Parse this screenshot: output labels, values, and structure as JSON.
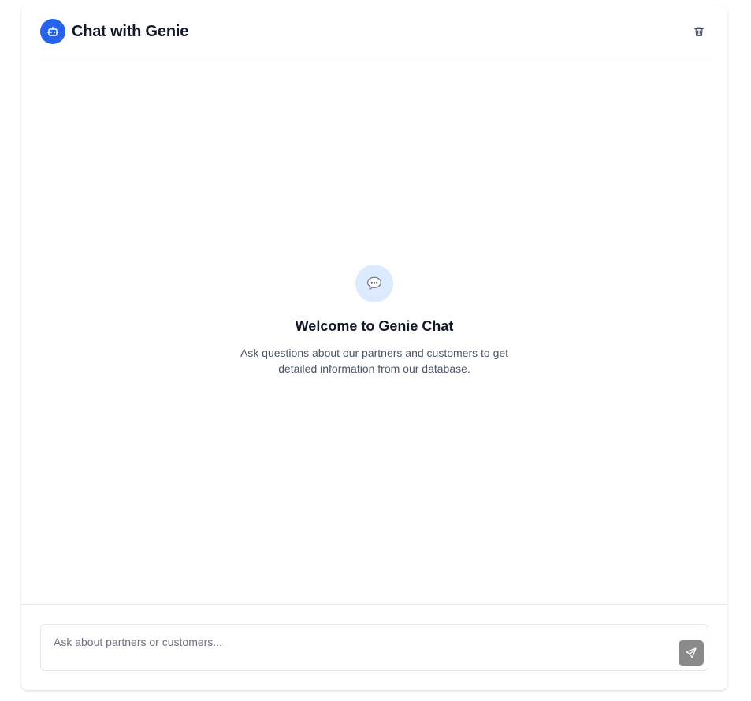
{
  "header": {
    "title": "Chat with Genie",
    "avatar_icon": "bot-icon",
    "clear_icon": "trash-icon"
  },
  "welcome": {
    "icon": "speech-bubble-icon",
    "title": "Welcome to Genie Chat",
    "description": "Ask questions about our partners and customers to get detailed information from our database."
  },
  "composer": {
    "placeholder": "Ask about partners or customers...",
    "value": "",
    "send_icon": "send-icon"
  },
  "colors": {
    "accent": "#2563eb",
    "accent_light": "#dbeafe",
    "send_disabled": "#8a8a8a",
    "border": "#e5e7eb"
  }
}
